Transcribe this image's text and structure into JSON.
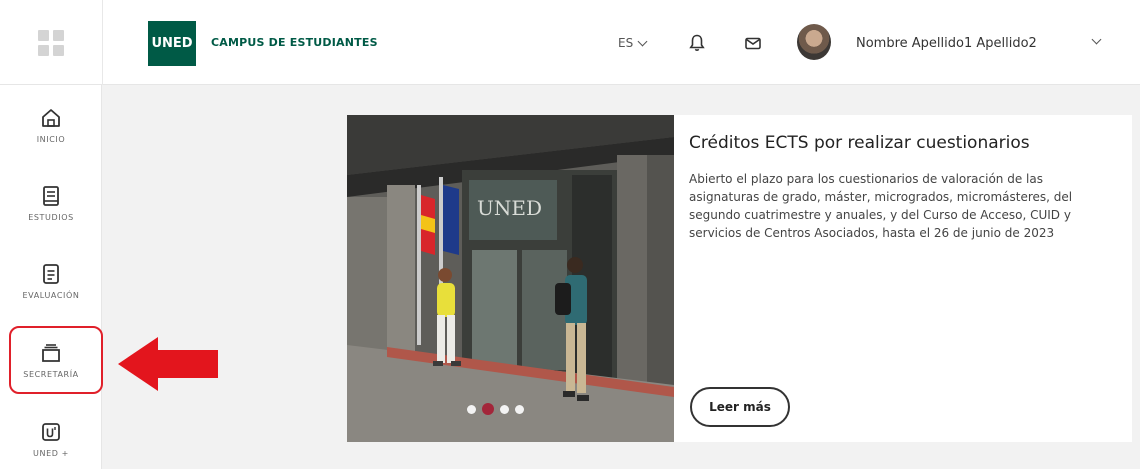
{
  "header": {
    "logo_text": "UNED",
    "campus_title": "CAMPUS DE ESTUDIANTES",
    "language": "ES",
    "user_name": "Nombre Apellido1 Apellido2"
  },
  "sidebar": {
    "items": [
      {
        "label": "INICIO",
        "icon": "home-icon"
      },
      {
        "label": "ESTUDIOS",
        "icon": "book-icon"
      },
      {
        "label": "EVALUACIÓN",
        "icon": "evaluation-icon"
      },
      {
        "label": "SECRETARÍA",
        "icon": "folder-icon"
      },
      {
        "label": "UNED +",
        "icon": "uned-plus-icon"
      }
    ],
    "highlighted_item": "SECRETARÍA"
  },
  "news": {
    "title": "Créditos ECTS por realizar cuestionarios",
    "body": "Abierto el plazo para los cuestionarios de valoración de las asignaturas de grado, máster, microgrados, micromásteres, del segundo cuatrimestre y anuales, y del Curso de Acceso, CUID y servicios de Centros Asociados, hasta el 26 de junio de 2023",
    "button_label": "Leer más",
    "photo_sign": "UNED",
    "carousel_total": 4,
    "carousel_active": 2
  },
  "colors": {
    "brand_green": "#005a46",
    "highlight_red": "#e0202a",
    "active_dot": "#a3263a"
  }
}
